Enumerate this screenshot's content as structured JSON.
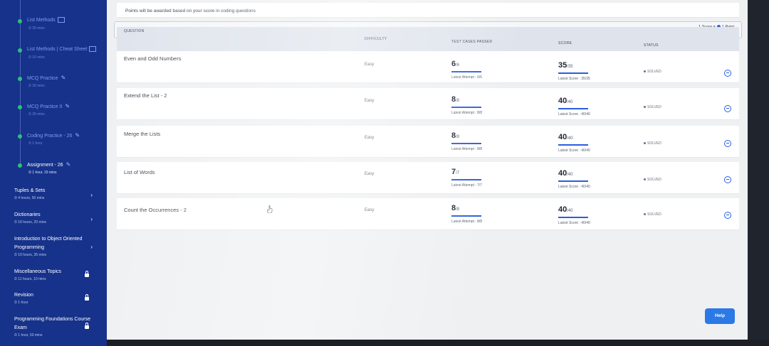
{
  "sidebar": {
    "lessons": [
      {
        "title": "List Methods",
        "meta": "30 mins",
        "icon": "cheat-sheet-icon",
        "active": false
      },
      {
        "title": "List Methods | Cheat Sheet",
        "meta": "10 mins",
        "icon": "cheat-sheet-icon",
        "active": false
      },
      {
        "title": "MCQ Practice",
        "meta": "30 mins",
        "icon": "pencil-icon",
        "active": false
      },
      {
        "title": "MCQ Practice II",
        "meta": "35 mins",
        "icon": "pencil-icon",
        "active": false
      },
      {
        "title": "Coding Practice - 26",
        "meta": "1 hour",
        "icon": "pencil-icon",
        "active": false
      },
      {
        "title": "Assignment - 26",
        "meta": "1 hour, 15 mins",
        "icon": "pencil-icon",
        "active": true
      }
    ],
    "topics": [
      {
        "title": "Tuples & Sets",
        "meta": "4 hours, 50 mins",
        "icon": "chevron-right-icon"
      },
      {
        "title": "Dictionaries",
        "meta": "16 hours, 20 mins",
        "icon": "chevron-right-icon"
      },
      {
        "title": "Introduction to Object Oriented Programming",
        "meta": "10 hours, 35 mins",
        "icon": "chevron-right-icon"
      },
      {
        "title": "Miscellaneous Topics",
        "meta": "11 hours, 10 mins",
        "icon": "lock-icon"
      },
      {
        "title": "Revision",
        "meta": "1 hour",
        "icon": "lock-icon"
      },
      {
        "title": "Programming Foundations Course Exam",
        "meta": "1 hour, 50 mins",
        "icon": "lock-icon"
      }
    ]
  },
  "notice": "Points will be awarded based on your score in coding questions",
  "score_legend": {
    "left": "1 Score =",
    "right": "1 Point"
  },
  "table": {
    "headers": {
      "question": "QUESTION",
      "difficulty": "DIFFICULTY",
      "test_cases": "TEST CASES PASSED",
      "score": "SCORE",
      "status": "STATUS"
    },
    "rows": [
      {
        "question": "Even and Odd Numbers",
        "difficulty": "Easy",
        "passed": "6",
        "total": "/6",
        "attempt": "Latest Attempt : 6/6",
        "score": "35",
        "score_total": "/35",
        "latest_score": "Latest Score : 35/35",
        "status": "SOLVED"
      },
      {
        "question": "Extend the List - 2",
        "difficulty": "Easy",
        "passed": "8",
        "total": "/8",
        "attempt": "Latest Attempt : 8/8",
        "score": "40",
        "score_total": "/40",
        "latest_score": "Latest Score : 40/40",
        "status": "SOLVED"
      },
      {
        "question": "Merge the Lists",
        "difficulty": "Easy",
        "passed": "8",
        "total": "/8",
        "attempt": "Latest Attempt : 8/8",
        "score": "40",
        "score_total": "/40",
        "latest_score": "Latest Score : 40/40",
        "status": "SOLVED"
      },
      {
        "question": "List of Words",
        "difficulty": "Easy",
        "passed": "7",
        "total": "/7",
        "attempt": "Latest Attempt : 7/7",
        "score": "40",
        "score_total": "/40",
        "latest_score": "Latest Score : 40/40",
        "status": "SOLVED"
      },
      {
        "question": "Count the Occurrences - 2",
        "difficulty": "Easy",
        "passed": "8",
        "total": "/8",
        "attempt": "Latest Attempt : 8/8",
        "score": "40",
        "score_total": "/40",
        "latest_score": "Latest Score : 40/40",
        "status": "SOLVED"
      }
    ]
  },
  "help_label": "Help",
  "colors": {
    "sidebar_bg": "#16328a",
    "accent": "#2a5de0",
    "complete": "#2ac27a"
  }
}
